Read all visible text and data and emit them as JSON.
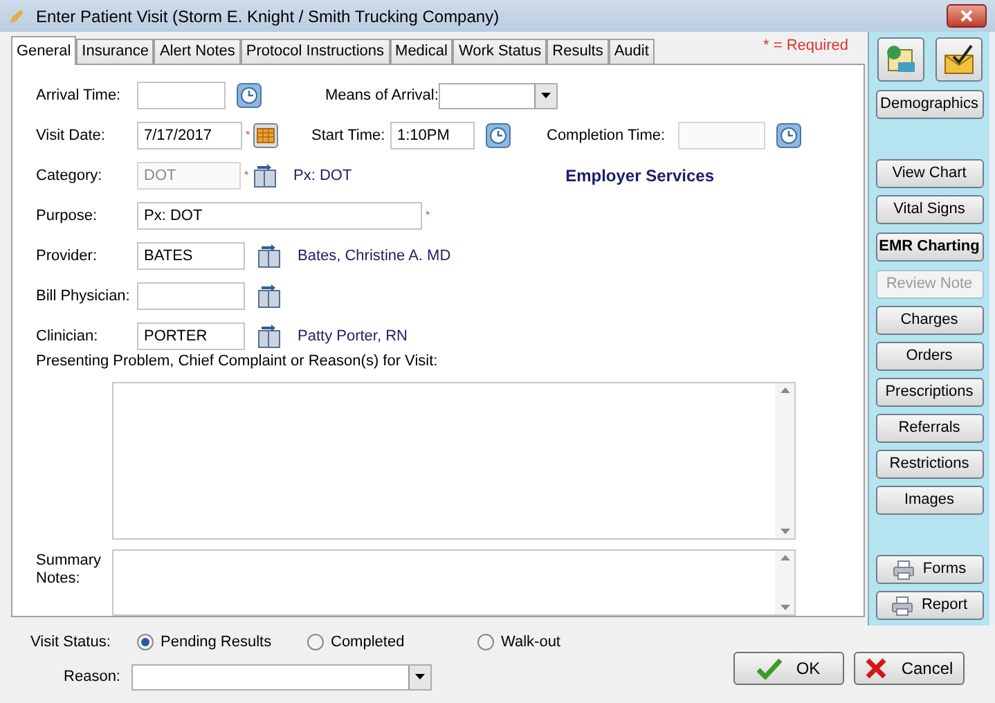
{
  "window": {
    "title": "Enter Patient Visit (Storm E. Knight / Smith Trucking Company)"
  },
  "tabs": [
    {
      "label": "General",
      "selected": true
    },
    {
      "label": "Insurance",
      "selected": false
    },
    {
      "label": "Alert Notes",
      "selected": false
    },
    {
      "label": "Protocol Instructions",
      "selected": false
    },
    {
      "label": "Medical",
      "selected": false
    },
    {
      "label": "Work Status",
      "selected": false
    },
    {
      "label": "Results",
      "selected": false
    },
    {
      "label": "Audit",
      "selected": false
    }
  ],
  "required_note": "* = Required",
  "required_mark": "*",
  "rows": [
    {
      "fields": [
        {
          "kind": "text",
          "label": "Arrival Time:",
          "button": {
            "kind": "clock"
          },
          "required": false,
          "disabled": false
        },
        {
          "kind": "dropdown",
          "label": "Means of Arrival:"
        }
      ]
    },
    {
      "fields": [
        {
          "kind": "text",
          "label": "Visit Date:",
          "value": "7/17/2017",
          "button": {
            "kind": "calendar"
          },
          "required": true,
          "disabled": false
        },
        {
          "kind": "text",
          "label": "Start Time:",
          "value": "1:10PM",
          "button": {
            "kind": "clock"
          },
          "required": false,
          "disabled": false
        },
        {
          "kind": "text",
          "label": "Completion Time:",
          "button": {
            "kind": "clock"
          },
          "required": false,
          "disabled": true
        }
      ]
    },
    {
      "fields": [
        {
          "kind": "text",
          "label": "Category:",
          "value": "DOT",
          "button": {
            "kind": "lookup"
          },
          "required": true,
          "disabled": true,
          "info": "Px: DOT"
        },
        {
          "kind": "note",
          "text": "Employer Services"
        }
      ]
    },
    {
      "fields": [
        {
          "kind": "text",
          "label": "Purpose:",
          "value": "Px: DOT",
          "required": true,
          "disabled": false
        }
      ]
    },
    {
      "fields": [
        {
          "kind": "text",
          "label": "Provider:",
          "value": "BATES",
          "button": {
            "kind": "lookup"
          },
          "required": false,
          "disabled": false,
          "info": "Bates, Christine A. MD"
        }
      ]
    },
    {
      "fields": [
        {
          "kind": "text",
          "label": "Bill Physician:",
          "button": {
            "kind": "lookup"
          },
          "required": false,
          "disabled": false
        }
      ]
    },
    {
      "fields": [
        {
          "kind": "text",
          "label": "Clinician:",
          "value": "PORTER",
          "button": {
            "kind": "lookup"
          },
          "required": false,
          "disabled": false,
          "info": "Patty Porter, RN"
        }
      ]
    }
  ],
  "presenting_problem": {
    "label": "Presenting Problem, Chief Complaint or Reason(s) for Visit:"
  },
  "summary_notes": {
    "label": "Summary Notes:"
  },
  "visit_status": {
    "label": "Visit Status:",
    "options": [
      {
        "label": "Pending Results",
        "selected": true
      },
      {
        "label": "Completed",
        "selected": false
      },
      {
        "label": "Walk-out",
        "selected": false
      }
    ]
  },
  "reason": {
    "label": "Reason:"
  },
  "side_buttons": [
    {
      "kind": "normal",
      "label": "Demographics",
      "disabled": false
    },
    {
      "kind": "normal",
      "label": "View Chart",
      "disabled": false
    },
    {
      "kind": "normal",
      "label": "Vital Signs",
      "disabled": false
    },
    {
      "kind": "bold",
      "label": "EMR Charting",
      "disabled": false
    },
    {
      "kind": "normal",
      "label": "Review Note",
      "disabled": true
    },
    {
      "kind": "normal",
      "label": "Charges",
      "disabled": false
    },
    {
      "kind": "normal",
      "label": "Orders",
      "disabled": false
    },
    {
      "kind": "normal",
      "label": "Prescriptions",
      "disabled": false
    },
    {
      "kind": "normal",
      "label": "Referrals",
      "disabled": false
    },
    {
      "kind": "normal",
      "label": "Restrictions",
      "disabled": false
    },
    {
      "kind": "normal",
      "label": "Images",
      "disabled": false
    },
    {
      "kind": "print",
      "label": "Forms",
      "disabled": false
    },
    {
      "kind": "print",
      "label": "Report",
      "disabled": false
    }
  ],
  "actions": [
    {
      "kind": "ok",
      "label": "OK"
    },
    {
      "kind": "cancel",
      "label": "Cancel"
    }
  ]
}
